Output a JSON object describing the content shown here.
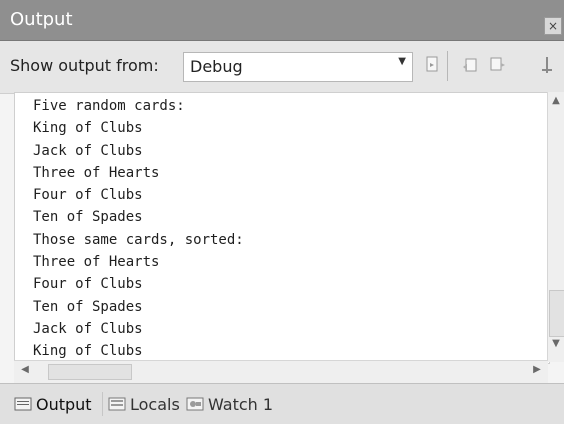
{
  "window": {
    "title": "Output",
    "close_glyph": "×"
  },
  "toolbar": {
    "show_output_label": "Show output from:",
    "source": {
      "selected": "Debug"
    },
    "icons": [
      "go-to-next-message-icon",
      "go-to-previous-message-icon",
      "clear-all-icon",
      "word-wrap-icon"
    ]
  },
  "output": {
    "lines": [
      "Five random cards:",
      "King of Clubs",
      "Jack of Clubs",
      "Three of Hearts",
      "Four of Clubs",
      "Ten of Spades",
      "Those same cards, sorted:",
      "Three of Hearts",
      "Four of Clubs",
      "Ten of Spades",
      "Jack of Clubs",
      "King of Clubs"
    ]
  },
  "scrollbar": {
    "up": "▲",
    "down": "▼",
    "left": "◀",
    "right": "▶"
  },
  "tabs": {
    "output": "Output",
    "locals": "Locals",
    "watch": "Watch 1"
  },
  "colors": {
    "title_bar": "#8f8f8f",
    "toolbar": "#e6e6e6",
    "output_bg": "#ffffff"
  }
}
